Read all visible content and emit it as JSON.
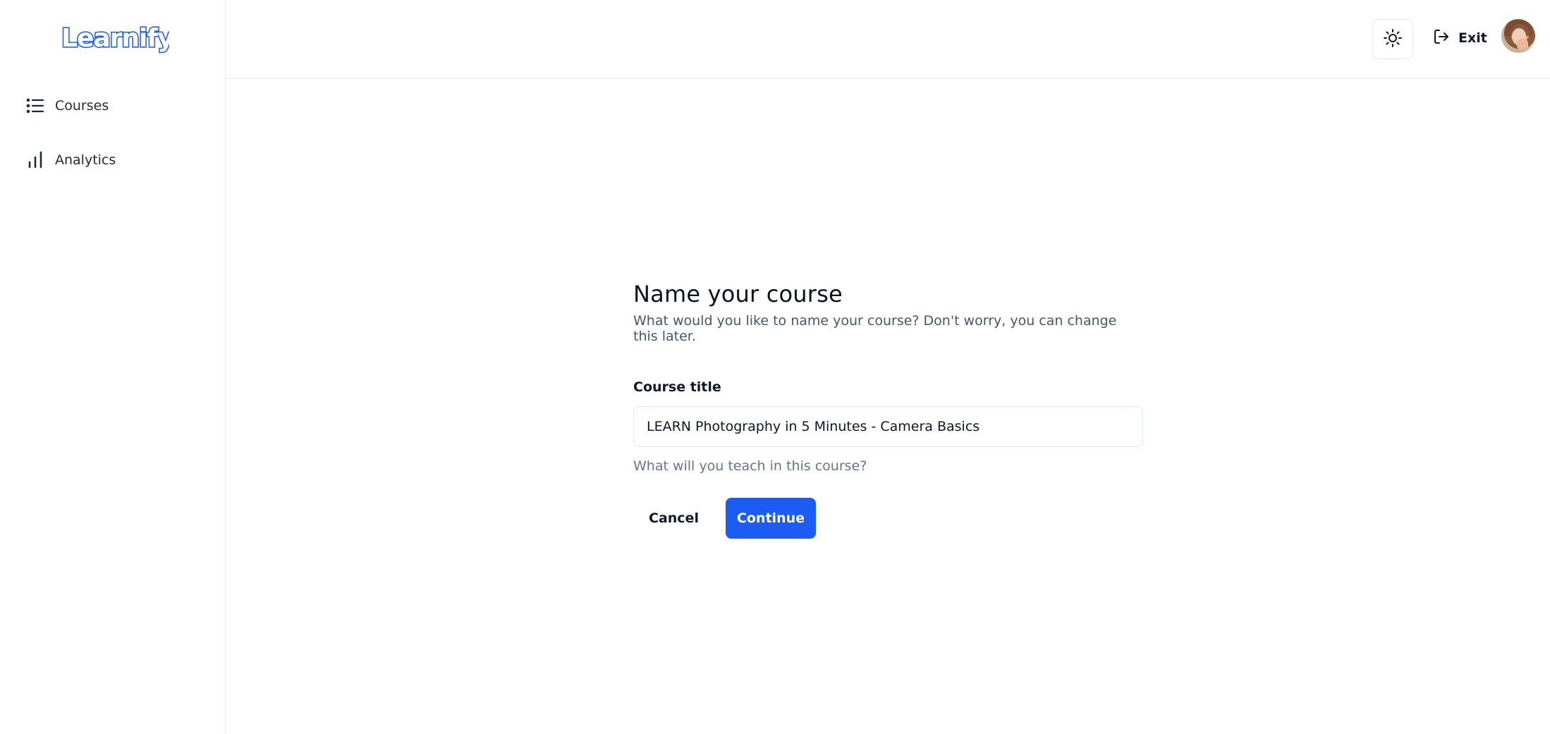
{
  "brand": {
    "logo_text": "Learnify",
    "color": "#2563eb"
  },
  "sidebar": {
    "items": [
      {
        "label": "Courses",
        "icon": "list-icon"
      },
      {
        "label": "Analytics",
        "icon": "bar-chart-icon"
      }
    ]
  },
  "header": {
    "theme_toggle_icon": "sun-icon",
    "exit_label": "Exit",
    "exit_icon": "log-out-icon",
    "avatar": "user-avatar"
  },
  "form": {
    "title": "Name your course",
    "subtitle": "What would you like to name your course? Don't worry, you can change this later.",
    "field_label": "Course title",
    "field_value": "LEARN Photography in 5 Minutes - Camera Basics",
    "helper": "What will you teach in this course?",
    "cancel_label": "Cancel",
    "continue_label": "Continue"
  },
  "colors": {
    "accent": "#1d5cf2",
    "border": "#e5e7eb",
    "muted_text": "#64748b"
  }
}
